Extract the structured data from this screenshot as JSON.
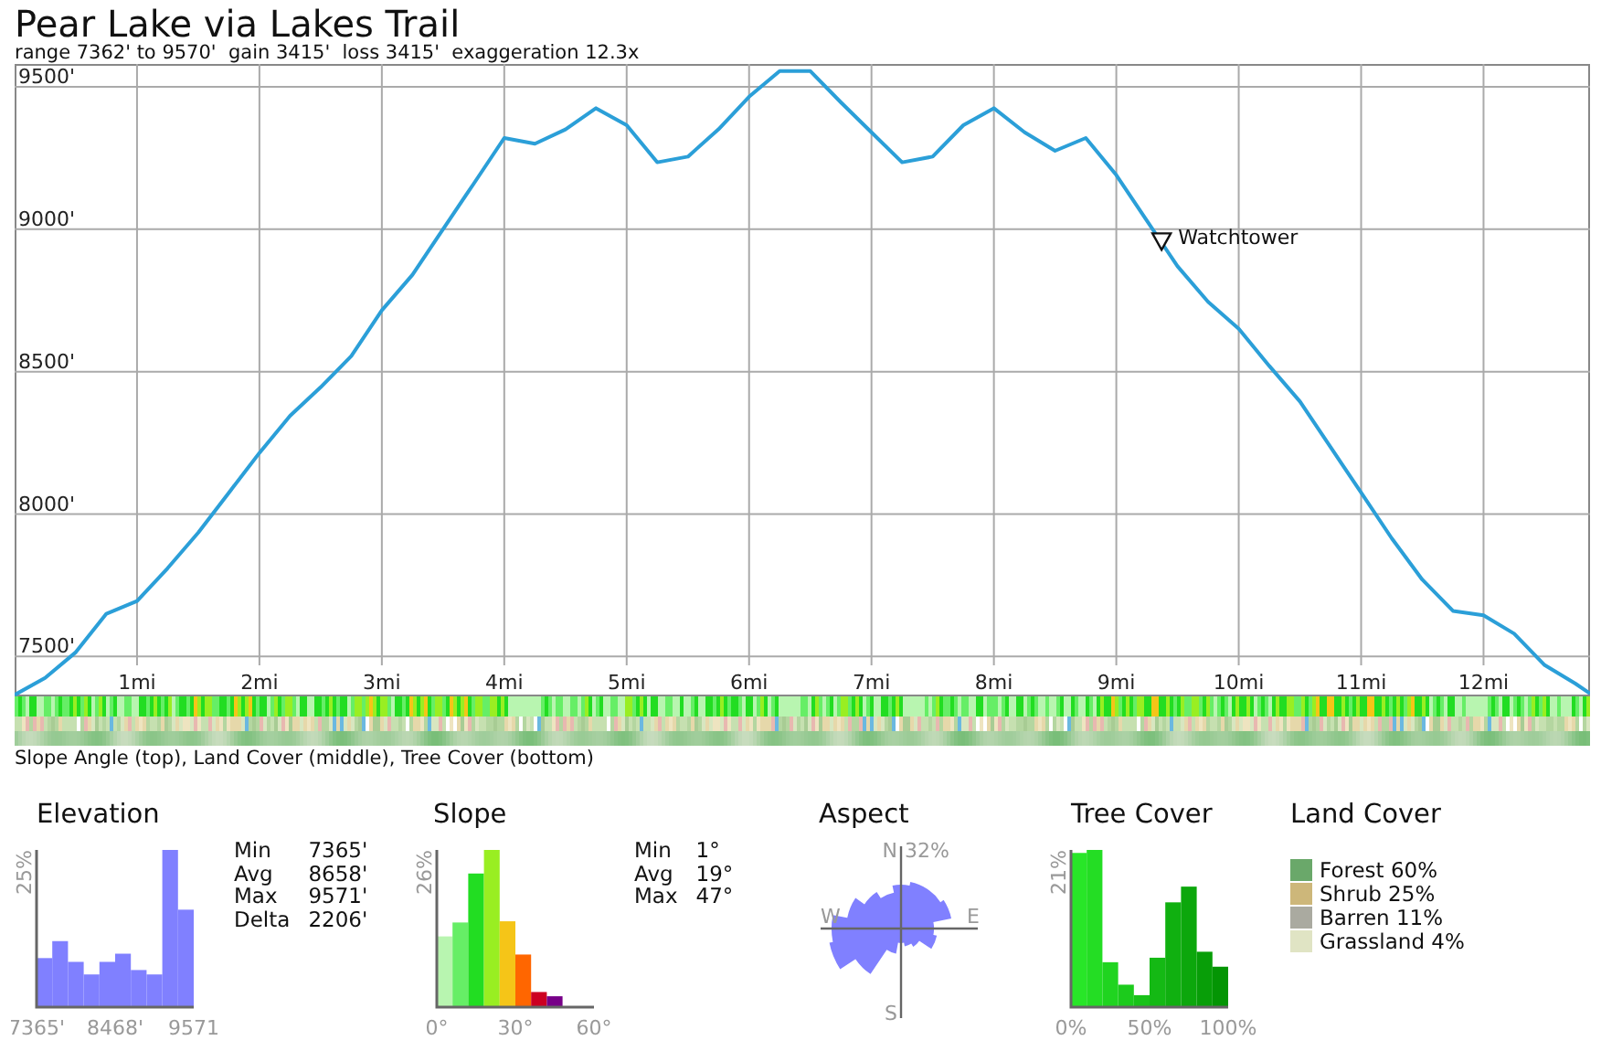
{
  "title": "Pear Lake via Lakes Trail",
  "summary": "range 7362' to 9570'  gain 3415'  loss 3415'  exaggeration 12.3x",
  "profile": {
    "chart_data": {
      "type": "line",
      "grid": true,
      "x": [
        0,
        0.25,
        0.5,
        0.75,
        1,
        1.25,
        1.5,
        1.75,
        2,
        2.25,
        2.5,
        2.75,
        3,
        3.25,
        3.5,
        3.75,
        4,
        4.25,
        4.5,
        4.75,
        5,
        5.25,
        5.5,
        5.75,
        6,
        6.25,
        6.5,
        6.75,
        7,
        7.25,
        7.5,
        7.75,
        8,
        8.25,
        8.5,
        8.75,
        9,
        9.25,
        9.5,
        9.75,
        10,
        10.25,
        10.5,
        10.75,
        11,
        11.25,
        11.5,
        11.75,
        12,
        12.25,
        12.5,
        12.75,
        12.87
      ],
      "values": [
        7365,
        7425,
        7515,
        7650,
        7695,
        7810,
        7935,
        8075,
        8215,
        8345,
        8445,
        8555,
        8715,
        8840,
        9000,
        9160,
        9320,
        9300,
        9350,
        9425,
        9365,
        9235,
        9255,
        9350,
        9465,
        9555,
        9555,
        9445,
        9340,
        9235,
        9255,
        9365,
        9425,
        9340,
        9275,
        9320,
        9190,
        9030,
        8870,
        8745,
        8650,
        8520,
        8395,
        8235,
        8075,
        7915,
        7770,
        7660,
        7645,
        7580,
        7470,
        7405,
        7370
      ],
      "xlim": [
        0,
        12.87
      ],
      "ylim": [
        7360,
        9580
      ],
      "xticks": [
        {
          "value": 1,
          "label": "1mi"
        },
        {
          "value": 2,
          "label": "2mi"
        },
        {
          "value": 3,
          "label": "3mi"
        },
        {
          "value": 4,
          "label": "4mi"
        },
        {
          "value": 5,
          "label": "5mi"
        },
        {
          "value": 6,
          "label": "6mi"
        },
        {
          "value": 7,
          "label": "7mi"
        },
        {
          "value": 8,
          "label": "8mi"
        },
        {
          "value": 9,
          "label": "9mi"
        },
        {
          "value": 10,
          "label": "10mi"
        },
        {
          "value": 11,
          "label": "11mi"
        },
        {
          "value": 12,
          "label": "12mi"
        }
      ],
      "yticks": [
        {
          "value": 7500,
          "label": "7500'"
        },
        {
          "value": 8000,
          "label": "8000'"
        },
        {
          "value": 8500,
          "label": "8500'"
        },
        {
          "value": 9000,
          "label": "9000'"
        },
        {
          "value": 9500,
          "label": "9500'"
        }
      ],
      "annotations": [
        "Watchtower"
      ]
    }
  },
  "strips_caption": "Slope Angle (top), Land Cover (middle), Tree Cover (bottom)",
  "elevation": {
    "title": "Elevation",
    "histogram": {
      "y_label": "25%",
      "x_labels": [
        "7365'",
        "8468'",
        "9571"
      ]
    },
    "stats": [
      {
        "label": "Min",
        "value": "7365'"
      },
      {
        "label": "Avg",
        "value": "8658'"
      },
      {
        "label": "Max",
        "value": "9571'"
      },
      {
        "label": "Delta",
        "value": "2206'"
      }
    ]
  },
  "slope": {
    "title": "Slope",
    "histogram": {
      "y_label": "26%",
      "x_labels": [
        "0°",
        "30°",
        "60°"
      ]
    },
    "stats": [
      {
        "label": "Min",
        "value": "1°"
      },
      {
        "label": "Avg",
        "value": "19°"
      },
      {
        "label": "Max",
        "value": "47°"
      }
    ]
  },
  "aspect": {
    "title": "Aspect",
    "north": "N",
    "east": "E",
    "south": "S",
    "west": "W",
    "scale": "32%"
  },
  "tree_cover": {
    "title": "Tree Cover",
    "histogram": {
      "y_label": "21%",
      "x_labels": [
        "0%",
        "50%",
        "100%"
      ]
    }
  },
  "land_cover": {
    "title": "Land Cover",
    "items": [
      {
        "label": "Forest 60%",
        "color": "#6aa86a"
      },
      {
        "label": "Shrub 25%",
        "color": "#cdb77a"
      },
      {
        "label": "Barren 11%",
        "color": "#aaaaa0"
      },
      {
        "label": "Grassland 4%",
        "color": "#e0e4c4"
      }
    ]
  }
}
